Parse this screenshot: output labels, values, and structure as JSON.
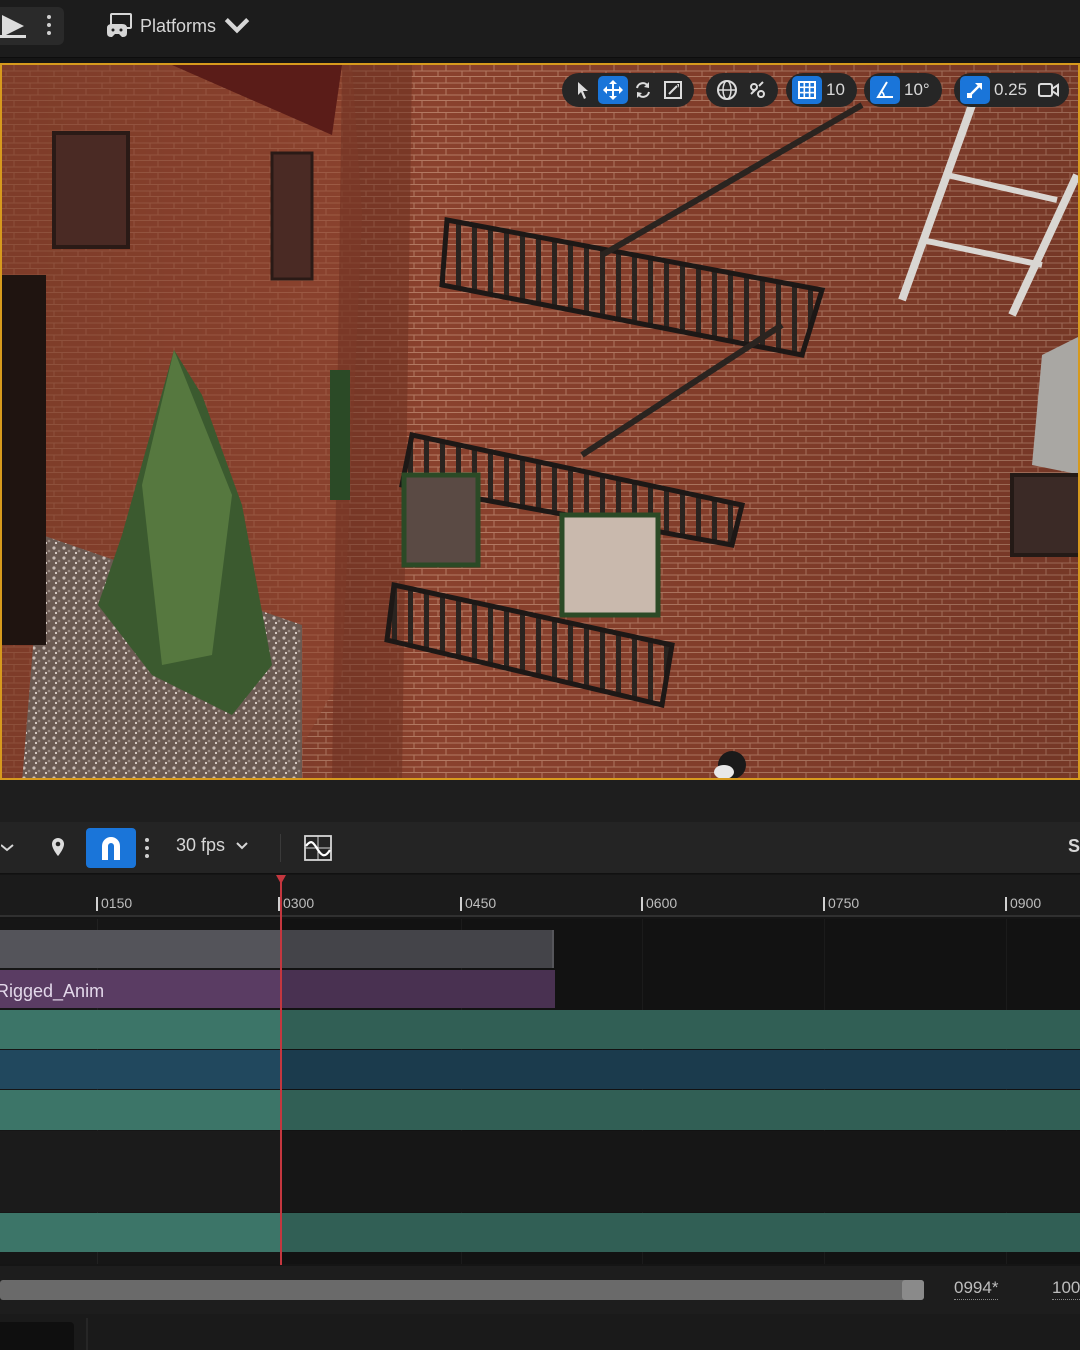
{
  "topbar": {
    "platforms_label": "Platforms",
    "icons": [
      "play-icon",
      "more-icon",
      "platforms-icon",
      "chevron-down-icon"
    ]
  },
  "viewport_toolbar": {
    "grid_snap": "10",
    "rotation_snap": "10°",
    "scale_snap": "0.25",
    "icons": [
      "select-icon",
      "translate-icon",
      "rotate-icon",
      "scale-icon",
      "world-icon",
      "surface-snap-icon",
      "grid-icon",
      "angle-icon",
      "scale-snap-icon",
      "camera-icon"
    ]
  },
  "sequencer": {
    "fps_label": "30 fps",
    "truncated_label": "S",
    "ruler": [
      "0150",
      "0300",
      "0450",
      "0600",
      "0750",
      "0900"
    ],
    "tracks": [
      {
        "label": "",
        "color": "#54545a"
      },
      {
        "label": "Rigged_Anim",
        "color": "#5a3c63"
      },
      {
        "label": "",
        "color": "#3c7568"
      },
      {
        "label": "",
        "color": "#21485e"
      },
      {
        "label": "",
        "color": "#3c7568"
      },
      {
        "label": "",
        "color": "#1b1b1b"
      },
      {
        "label": "",
        "color": "#3c7568"
      }
    ],
    "range_end": "0994*",
    "range_max": "100"
  },
  "colors": {
    "viewport_border": "#d79a1d",
    "active_button": "#1a75d9",
    "playhead": "#c4373f"
  }
}
